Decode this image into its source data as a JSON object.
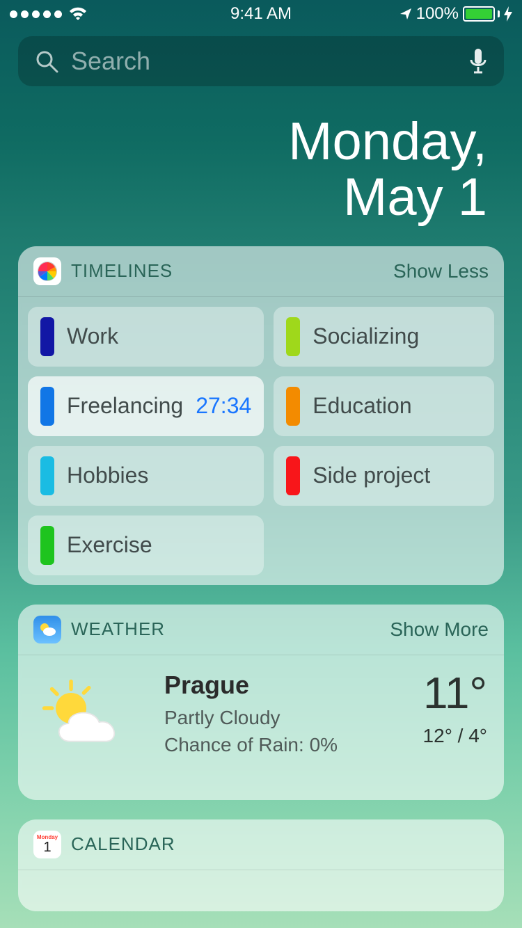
{
  "status": {
    "time": "9:41 AM",
    "battery_pct": "100%"
  },
  "search": {
    "placeholder": "Search"
  },
  "date": {
    "weekday": "Monday,",
    "month_day": "May 1"
  },
  "timelines": {
    "title": "TIMELINES",
    "toggle": "Show Less",
    "tiles": [
      {
        "label": "Work",
        "color": "#1217a5",
        "timer": null,
        "active": false
      },
      {
        "label": "Socializing",
        "color": "#9fd81b",
        "timer": null,
        "active": false
      },
      {
        "label": "Freelancing",
        "color": "#1176e6",
        "timer": "27:34",
        "active": true
      },
      {
        "label": "Education",
        "color": "#f38b00",
        "timer": null,
        "active": false
      },
      {
        "label": "Hobbies",
        "color": "#1abce3",
        "timer": null,
        "active": false
      },
      {
        "label": "Side project",
        "color": "#f8161a",
        "timer": null,
        "active": false
      },
      {
        "label": "Exercise",
        "color": "#1ec41e",
        "timer": null,
        "active": false
      }
    ]
  },
  "weather": {
    "title": "WEATHER",
    "toggle": "Show More",
    "location": "Prague",
    "condition": "Partly Cloudy",
    "rain": "Chance of Rain: 0%",
    "temp_now": "11°",
    "temp_hi_lo": "12° / 4°"
  },
  "calendar": {
    "title": "CALENDAR",
    "icon_top": "Monday",
    "icon_day": "1"
  }
}
